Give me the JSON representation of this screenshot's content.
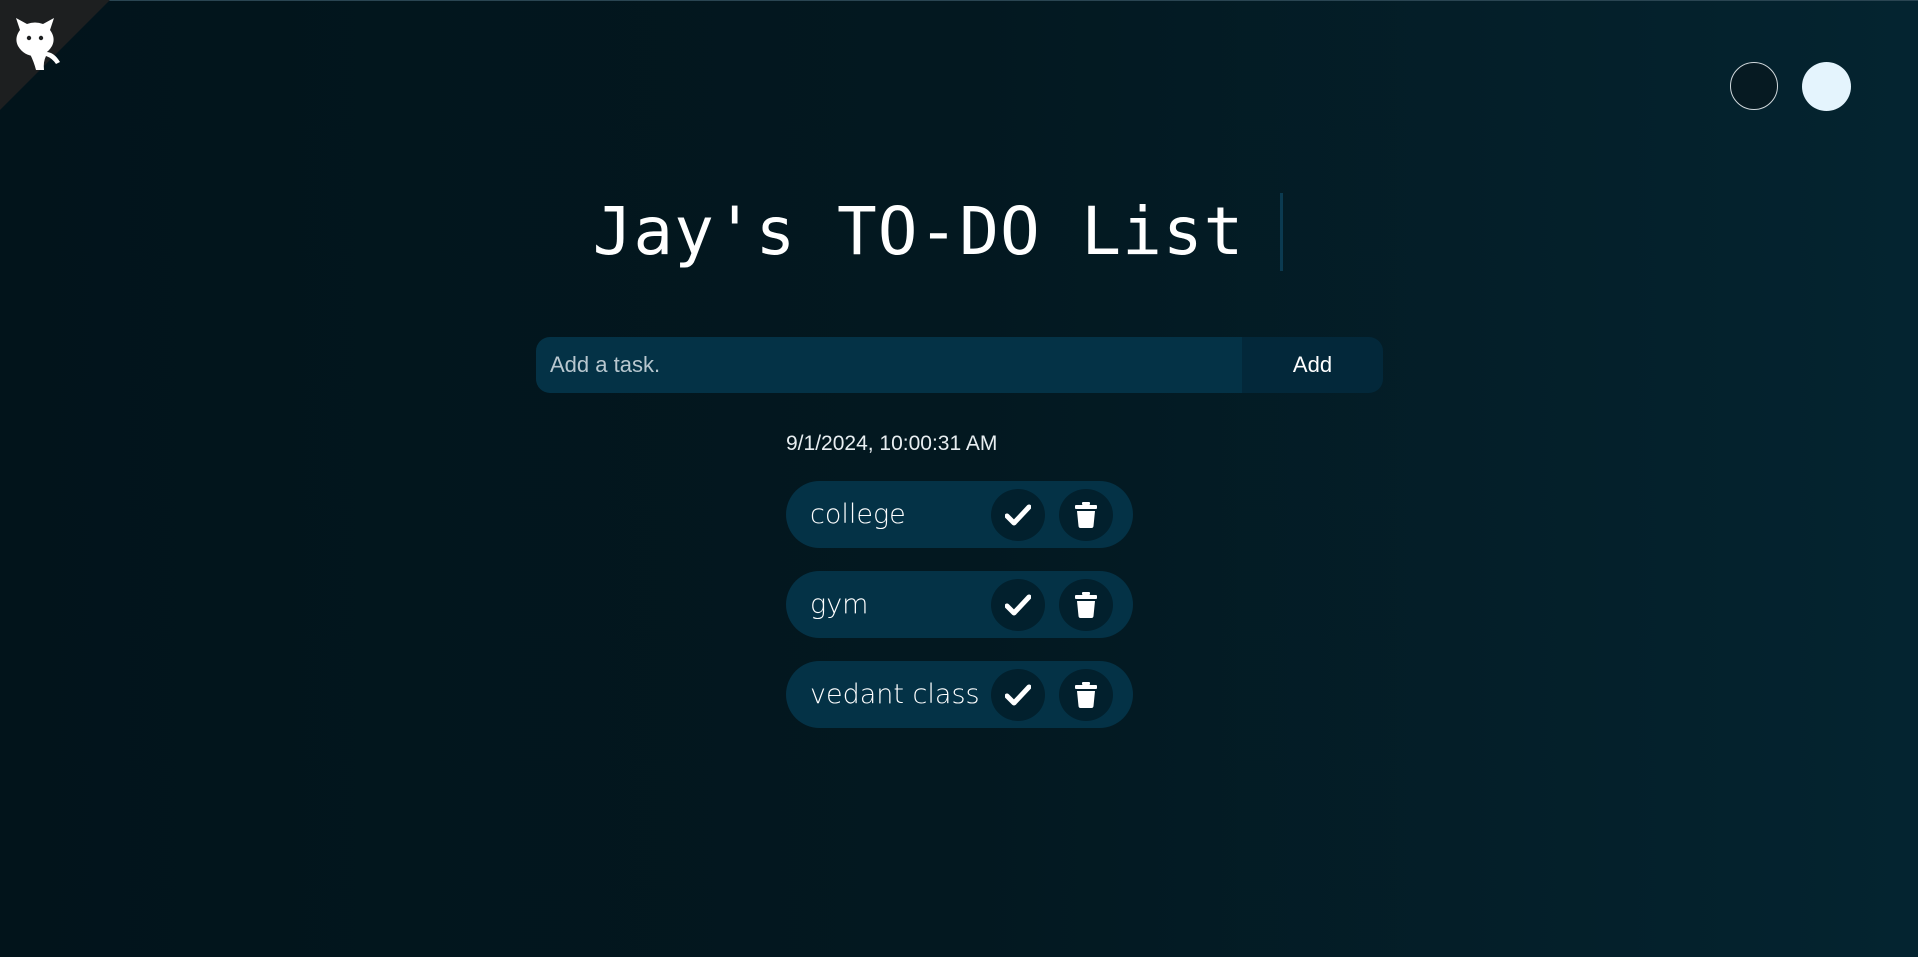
{
  "title": "Jay's TO-DO List",
  "input": {
    "placeholder": "Add a task.",
    "value": ""
  },
  "add_button_label": "Add",
  "timestamp": "9/1/2024, 10:00:31 AM",
  "tasks": [
    {
      "label": "college"
    },
    {
      "label": "gym"
    },
    {
      "label": "vedant class"
    }
  ],
  "icons": {
    "corner": "github-octocat-icon",
    "check": "check-icon",
    "delete": "trash-icon"
  },
  "colors": {
    "background": "#031820",
    "input_background": "#043246",
    "add_button_background": "#03283a",
    "task_background": "#043246",
    "icon_button_background": "#02202d",
    "light_theme_swatch": "#e4f4fd"
  }
}
